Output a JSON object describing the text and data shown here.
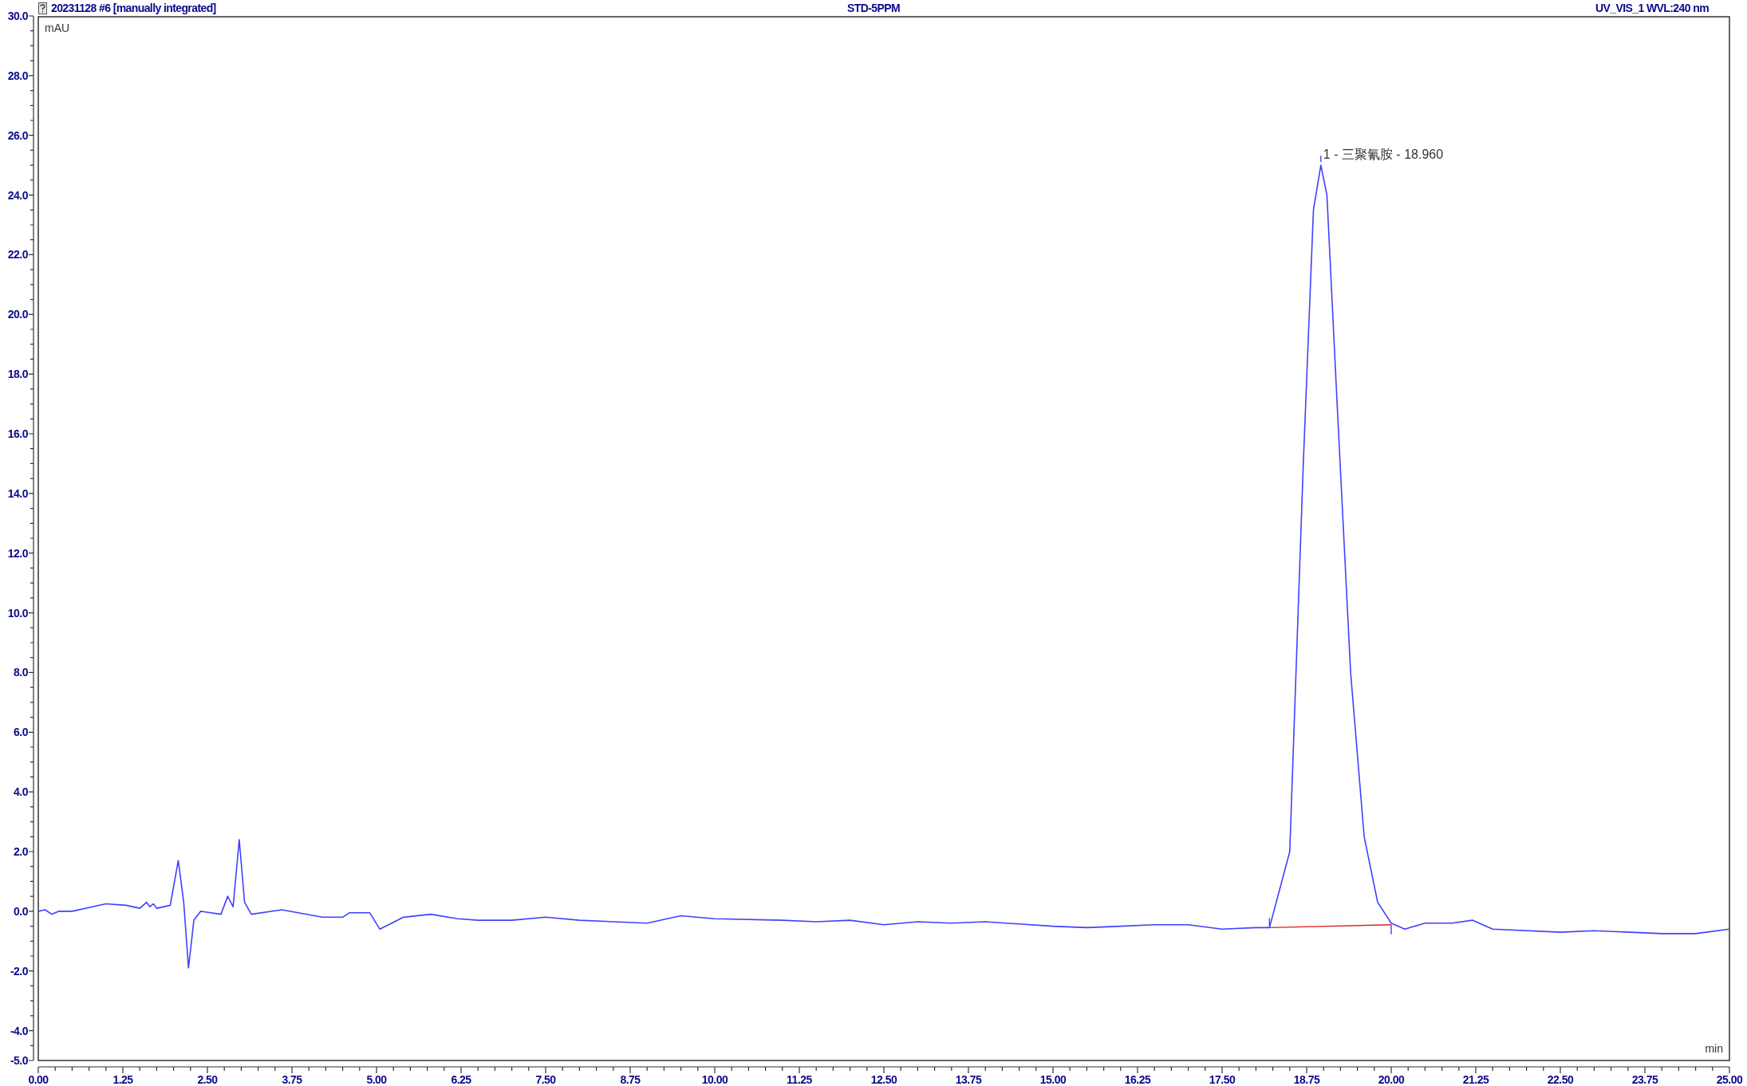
{
  "header": {
    "title": "20231128 #6 [manually integrated]",
    "sample": "STD-5PPM",
    "channel": "UV_VIS_1 WVL:240 nm"
  },
  "chromatogram": {
    "chart_data": {
      "type": "line",
      "xlabel": "min",
      "ylabel": "mAU",
      "xlim": [
        0,
        25
      ],
      "ylim": [
        -5,
        30
      ],
      "xticks": [
        {
          "value": 0,
          "label": "0.00"
        },
        {
          "value": 1.25,
          "label": "1.25"
        },
        {
          "value": 2.5,
          "label": "2.50"
        },
        {
          "value": 3.75,
          "label": "3.75"
        },
        {
          "value": 5,
          "label": "5.00"
        },
        {
          "value": 6.25,
          "label": "6.25"
        },
        {
          "value": 7.5,
          "label": "7.50"
        },
        {
          "value": 8.75,
          "label": "8.75"
        },
        {
          "value": 10,
          "label": "10.00"
        },
        {
          "value": 11.25,
          "label": "11.25"
        },
        {
          "value": 12.5,
          "label": "12.50"
        },
        {
          "value": 13.75,
          "label": "13.75"
        },
        {
          "value": 15,
          "label": "15.00"
        },
        {
          "value": 16.25,
          "label": "16.25"
        },
        {
          "value": 17.5,
          "label": "17.50"
        },
        {
          "value": 18.75,
          "label": "18.75"
        },
        {
          "value": 20,
          "label": "20.00"
        },
        {
          "value": 21.25,
          "label": "21.25"
        },
        {
          "value": 22.5,
          "label": "22.50"
        },
        {
          "value": 23.75,
          "label": "23.75"
        },
        {
          "value": 25,
          "label": "25.00"
        }
      ],
      "yticks": [
        {
          "value": 30,
          "label": "30.0"
        },
        {
          "value": 28,
          "label": "28.0"
        },
        {
          "value": 26,
          "label": "26.0"
        },
        {
          "value": 24,
          "label": "24.0"
        },
        {
          "value": 22,
          "label": "22.0"
        },
        {
          "value": 20,
          "label": "20.0"
        },
        {
          "value": 18,
          "label": "18.0"
        },
        {
          "value": 16,
          "label": "16.0"
        },
        {
          "value": 14,
          "label": "14.0"
        },
        {
          "value": 12,
          "label": "12.0"
        },
        {
          "value": 10,
          "label": "10.0"
        },
        {
          "value": 8,
          "label": "8.0"
        },
        {
          "value": 6,
          "label": "6.0"
        },
        {
          "value": 4,
          "label": "4.0"
        },
        {
          "value": 2,
          "label": "2.0"
        },
        {
          "value": 0,
          "label": "0.0"
        },
        {
          "value": -2,
          "label": "-2.0"
        },
        {
          "value": -4,
          "label": "-4.0"
        },
        {
          "value": -5,
          "label": "-5.0"
        }
      ],
      "x": [
        0,
        0.1,
        0.2,
        0.3,
        0.5,
        0.8,
        1.0,
        1.3,
        1.5,
        1.6,
        1.65,
        1.7,
        1.75,
        1.95,
        2.07,
        2.15,
        2.22,
        2.3,
        2.4,
        2.7,
        2.8,
        2.88,
        2.97,
        3.05,
        3.15,
        3.6,
        4.2,
        4.5,
        4.6,
        4.9,
        5.05,
        5.4,
        5.8,
        6.2,
        6.5,
        7,
        7.5,
        8,
        8.5,
        9,
        9.5,
        10,
        11,
        11.5,
        12,
        12.5,
        13,
        13.5,
        14,
        15,
        15.5,
        16,
        16.5,
        17,
        17.5,
        18,
        18.2,
        18.5,
        18.7,
        18.85,
        18.96,
        19.05,
        19.2,
        19.4,
        19.6,
        19.8,
        20,
        20.2,
        20.5,
        20.9,
        21.2,
        21.5,
        22.5,
        23,
        24,
        24.5,
        25
      ],
      "series": [
        {
          "color": "#4040ff",
          "values": [
            0,
            0.05,
            -0.1,
            0,
            0,
            0.15,
            0.25,
            0.2,
            0.1,
            0.3,
            0.15,
            0.25,
            0.1,
            0.2,
            1.7,
            0.3,
            -1.9,
            -0.3,
            0,
            -0.1,
            0.5,
            0.15,
            2.4,
            0.3,
            -0.1,
            0.05,
            -0.2,
            -0.2,
            -0.05,
            -0.05,
            -0.6,
            -0.2,
            -0.1,
            -0.25,
            -0.3,
            -0.3,
            -0.2,
            -0.3,
            -0.35,
            -0.4,
            -0.15,
            -0.25,
            -0.3,
            -0.35,
            -0.3,
            -0.45,
            -0.35,
            -0.4,
            -0.35,
            -0.5,
            -0.55,
            -0.5,
            -0.45,
            -0.45,
            -0.6,
            -0.55,
            -0.55,
            2.0,
            15,
            23.5,
            25.0,
            24,
            17,
            8,
            2.5,
            0.3,
            -0.4,
            -0.6,
            -0.4,
            -0.4,
            -0.3,
            -0.6,
            -0.7,
            -0.65,
            -0.75,
            -0.75,
            -0.6
          ]
        },
        {
          "color": "#e02020",
          "values": [
            null,
            null,
            null,
            null,
            null,
            null,
            null,
            null,
            null,
            null,
            null,
            null,
            null,
            null,
            null,
            null,
            null,
            null,
            null,
            null,
            null,
            null,
            null,
            null,
            null,
            null,
            null,
            null,
            null,
            null,
            null,
            null,
            null,
            null,
            null,
            null,
            null,
            null,
            null,
            null,
            null,
            null,
            null,
            null,
            null,
            null,
            null,
            null,
            null,
            null,
            null,
            null,
            null,
            null,
            null,
            null,
            -0.55,
            null,
            null,
            null,
            null,
            null,
            null,
            null,
            null,
            null,
            -0.45,
            null,
            null,
            null,
            null,
            null,
            null,
            null,
            null,
            null,
            null
          ]
        }
      ],
      "annotations": [
        {
          "text": "1 - 三聚氰胺 - 18.960",
          "x": 18.96,
          "y": 25.0
        }
      ]
    }
  }
}
